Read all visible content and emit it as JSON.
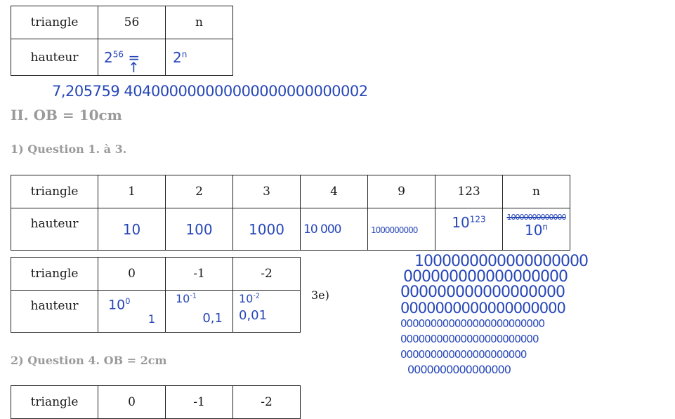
{
  "table_top": {
    "row_triangle": {
      "label": "triangle",
      "v1": "56",
      "v2": "n"
    },
    "row_hauteur": {
      "label": "hauteur",
      "h1_base": "2",
      "h1_exp": "56",
      "h1_eq": "=",
      "h2_base": "2",
      "h2_exp": "n"
    }
  },
  "annotation_top": {
    "arrow": "↑",
    "value": "7,205759 404000000000000000000000002"
  },
  "section_II": {
    "title": "II.  OB = 10cm"
  },
  "question_1": {
    "title": "1)  Question 1. à 3."
  },
  "table_mid": {
    "triangle_label": "triangle",
    "triangle_values": [
      "1",
      "2",
      "3",
      "4",
      "9",
      "123",
      "n"
    ],
    "hauteur_label": "hauteur",
    "hauteur_values": [
      "10",
      "100",
      "1000",
      "10 000",
      "1000000000"
    ],
    "h_123_base": "10",
    "h_123_exp": "123",
    "h_n_struck": "10000000000000",
    "h_n_base": "10",
    "h_n_exp": "n"
  },
  "table_neg": {
    "triangle_label": "triangle",
    "triangle_values": [
      "0",
      "-1",
      "-2"
    ],
    "hauteur_label": "hauteur",
    "h0_base": "10",
    "h0_exp": "0",
    "h0_val": "1",
    "h1_base": "10",
    "h1_exp": "-1",
    "h1_val": "0,1",
    "h2_base": "10",
    "h2_exp": "-2",
    "h2_val": "0,01"
  },
  "label_3e": "3e)",
  "big_number_lines": [
    "1000000000000000000",
    "000000000000000000",
    "000000000000000000",
    "0000000000000000000",
    "000000000000000000000000",
    "00000000000000000000000",
    "000000000000000000000",
    "0000000000000000"
  ],
  "question_2": {
    "title": "2)  Question 4. OB = 2cm"
  },
  "table_bottom": {
    "triangle_label": "triangle",
    "triangle_values": [
      "0",
      "-1",
      "-2"
    ]
  }
}
